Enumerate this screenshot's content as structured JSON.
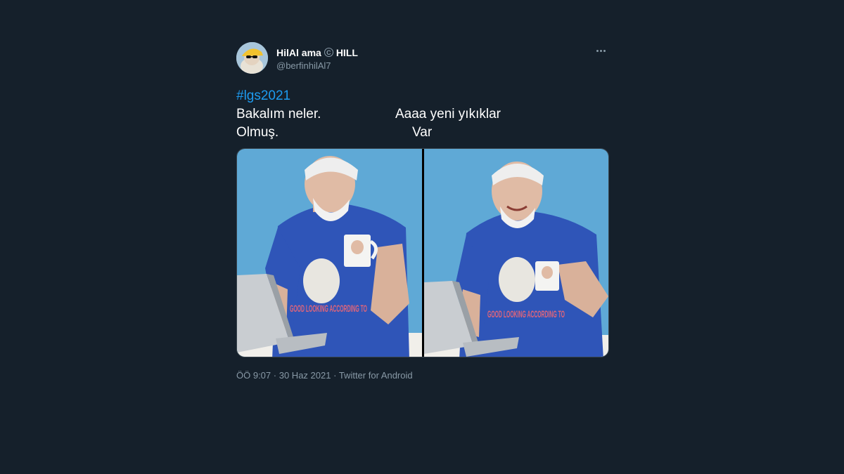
{
  "tweet": {
    "author": {
      "display_name": "HilAl ama",
      "badge_icon": "copyright-icon",
      "display_name_suffix": "HILL",
      "handle": "@berfinhilAl7"
    },
    "more_icon": "more-icon",
    "hashtag": "#lgs2021",
    "captions": {
      "left_line1": "Bakalım neler.",
      "left_line2": "Olmuş.",
      "right_line1": "Aaaa yeni yıkıklar",
      "right_line2": "Var"
    },
    "media": {
      "left_shirt_text": "GOOD LOOKING ACCORDING TO",
      "right_shirt_text": "GOOD LOOKING ACCORDING TO"
    },
    "meta": {
      "time": "ÖÖ 9:07",
      "separator": "·",
      "date": "30 Haz 2021",
      "source": "Twitter for Android"
    }
  },
  "colors": {
    "background": "#15202b",
    "link": "#1d9bf0",
    "secondary_text": "#8899a6",
    "photo_background": "#5fa9d6",
    "shirt": "#2f55b8"
  }
}
